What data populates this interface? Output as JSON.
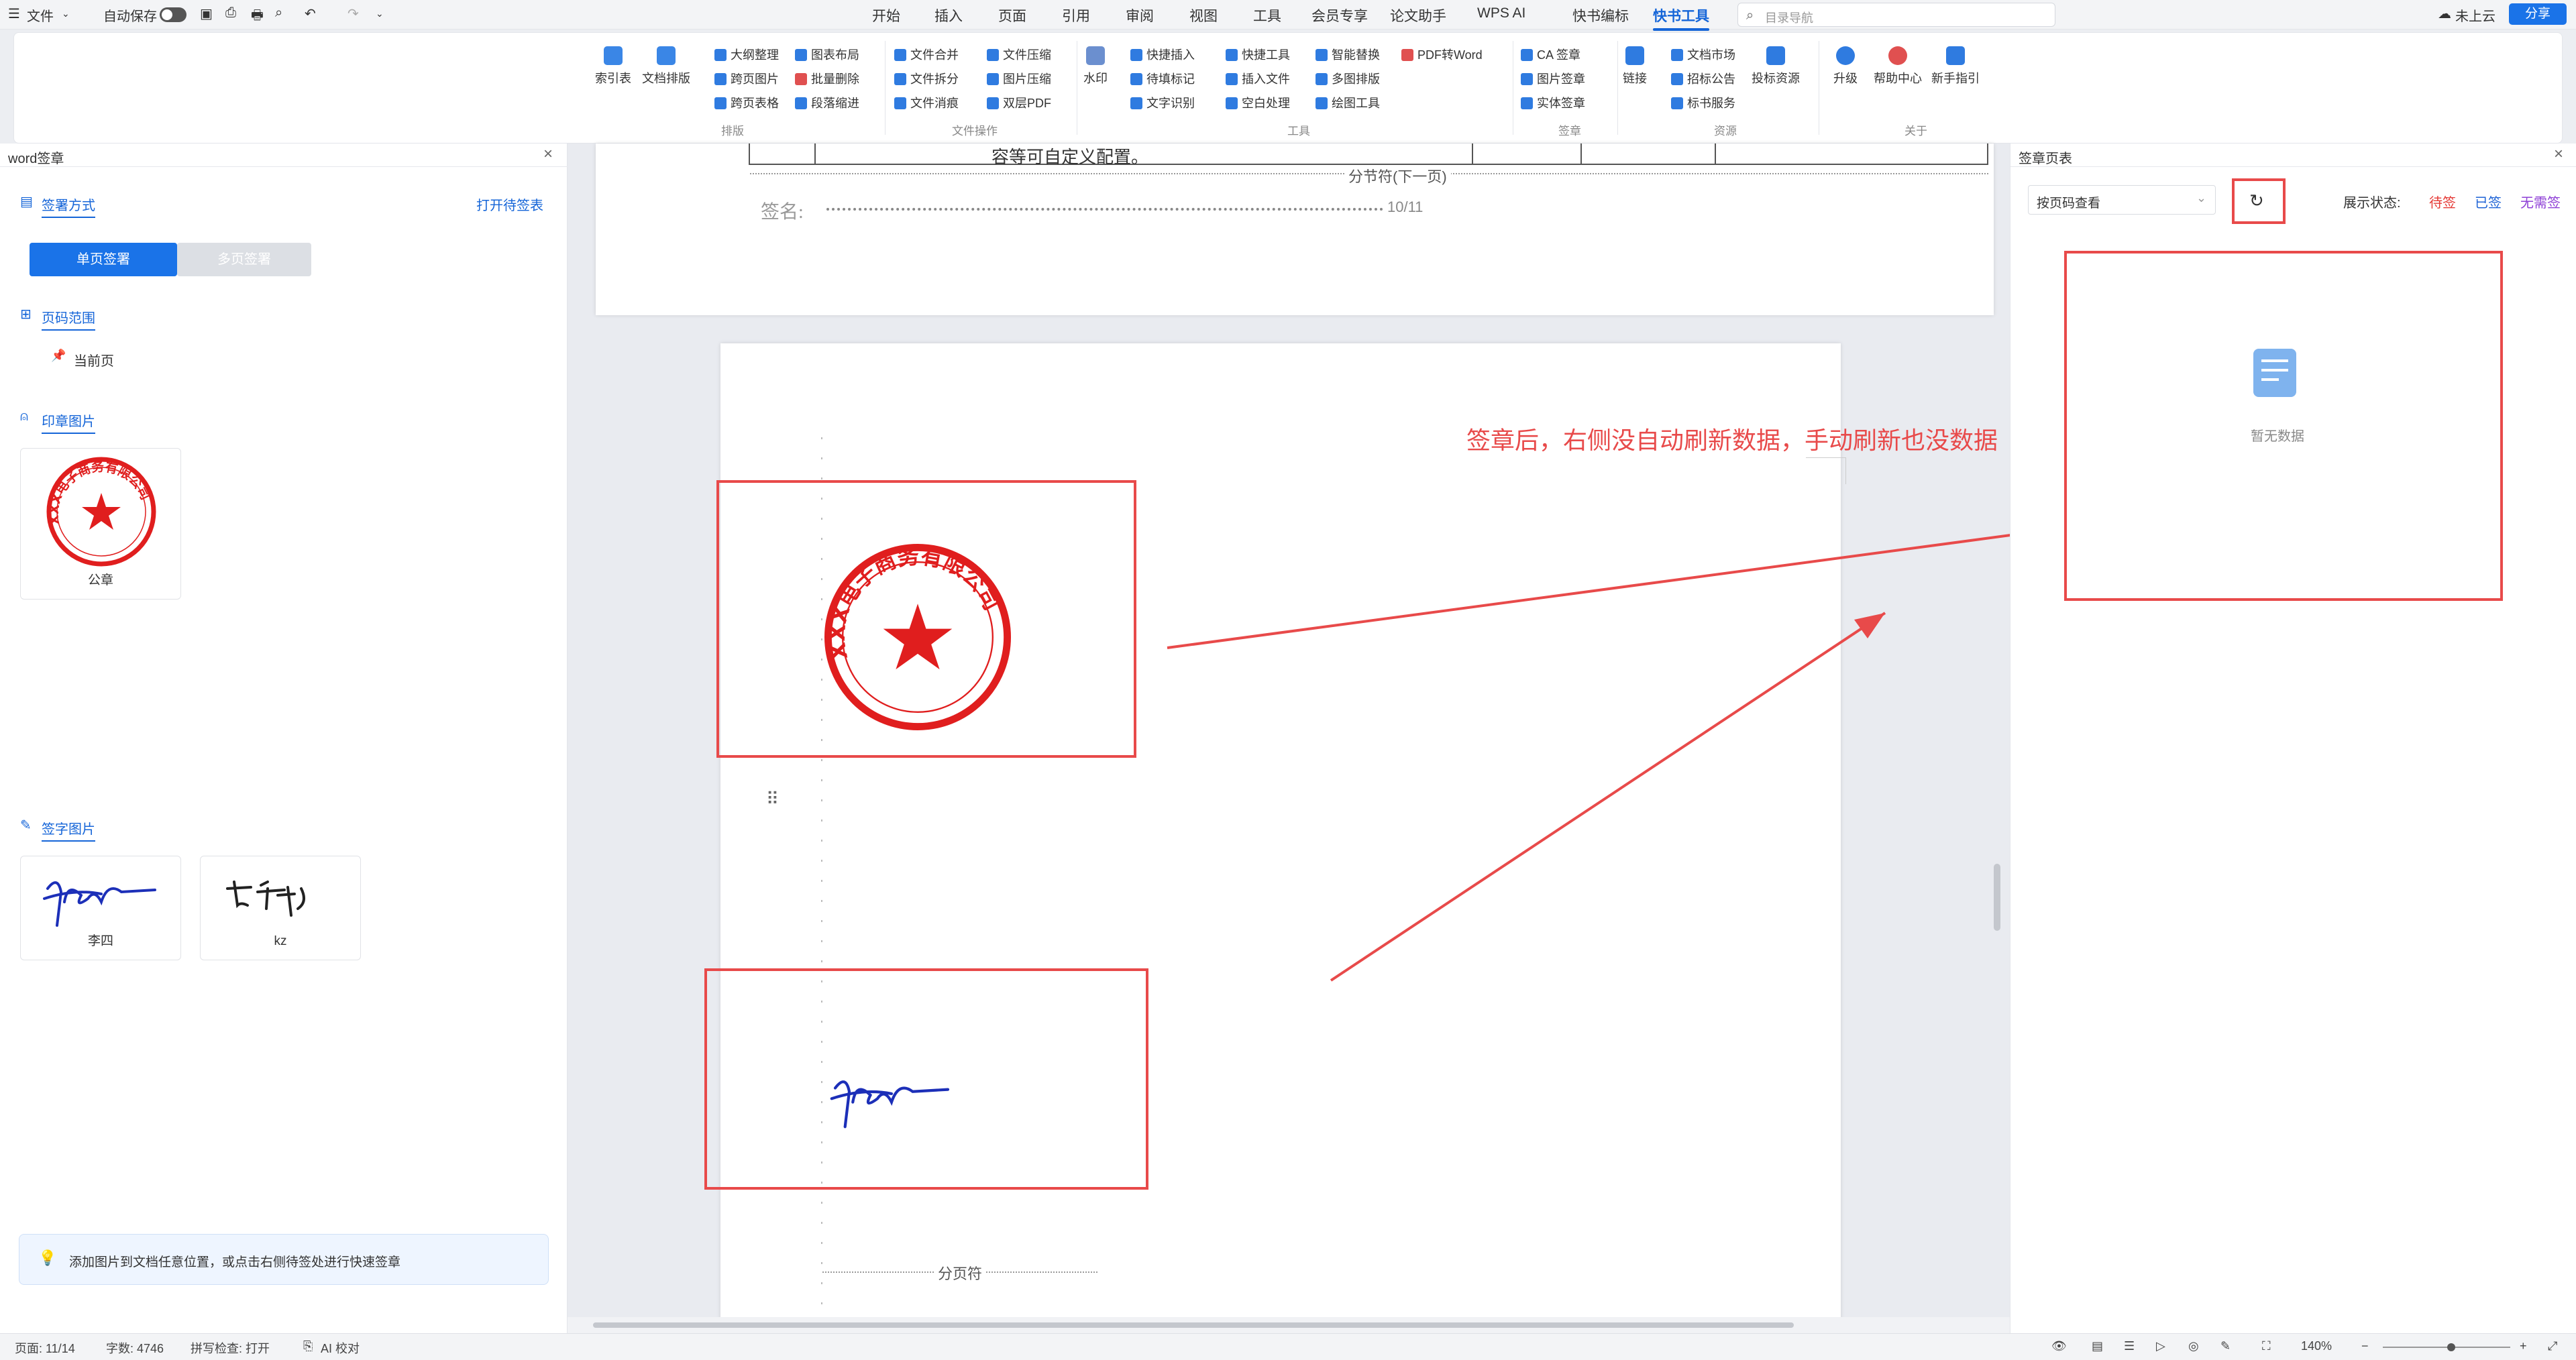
{
  "topbar": {
    "file_menu": "文件",
    "autosave_label": "自动保存",
    "tabs": [
      "开始",
      "插入",
      "页面",
      "引用",
      "审阅",
      "视图",
      "工具",
      "会员专享",
      "论文助手",
      "WPS AI",
      "快书编标",
      "快书工具"
    ],
    "active_tab": "快书工具",
    "search_placeholder": "目录导航",
    "cloud_status": "未上云",
    "share_label": "分享"
  },
  "ribbon": {
    "big_buttons": [
      "索引表",
      "文档排版",
      "水印",
      "链接",
      "投标资源",
      "升级",
      "帮助中心",
      "新手指引"
    ],
    "small_buttons": {
      "col1": [
        "大纲整理",
        "跨页图片",
        "跨页表格"
      ],
      "col2": [
        "图表布局",
        "批量删除",
        "段落缩进"
      ],
      "col3": [
        "文件合并",
        "文件拆分",
        "文件消痕"
      ],
      "col4": [
        "文件压缩",
        "图片压缩",
        "双层PDF"
      ],
      "col5": [
        "快捷插入",
        "待填标记",
        "文字识别"
      ],
      "col6": [
        "快捷工具",
        "插入文件",
        "空白处理"
      ],
      "col7": [
        "智能替换",
        "多图排版",
        "绘图工具"
      ],
      "col8": [
        "PDF转Word"
      ],
      "col9": [
        "CA 签章",
        "图片签章",
        "实体签章"
      ],
      "col10": [
        "文档市场",
        "招标公告",
        "标书服务"
      ]
    },
    "group_labels": [
      "排版",
      "文件操作",
      "工具",
      "签章",
      "资源",
      "关于"
    ]
  },
  "left_panel": {
    "title": "word签章",
    "section_sign_mode": "签署方式",
    "open_sign_table": "打开待签表",
    "mode_single": "单页签署",
    "mode_multi": "多页签署",
    "section_page_range": "页码范围",
    "current_page": "当前页",
    "section_seal_images": "印章图片",
    "seal_caption": "公章",
    "section_signature_images": "签字图片",
    "signatures": [
      "李四",
      "kz"
    ],
    "tip": "添加图片到文档任意位置，或点击右侧待签处进行快速签章"
  },
  "document": {
    "upper_text": "容等可自定义配置。",
    "section_break": "分节符(下一页)",
    "sign_label": "签名:",
    "sign_page": "10/11",
    "page_break": "分页符",
    "annotation": "签章后，右侧没自动刷新数据，手动刷新也没数据",
    "seal_text": "XXX电子商务有限公司"
  },
  "right_panel": {
    "title": "签章页表",
    "view_select": "按页码查看",
    "status_label": "展示状态:",
    "status_pending": "待签",
    "status_signed": "已签",
    "status_none": "无需签",
    "empty_text": "暂无数据",
    "colors": {
      "pending": "#e53935",
      "signed": "#1e63d6",
      "none": "#8e3fd6"
    }
  },
  "statusbar": {
    "page": "页面: 11/14",
    "words": "字数: 4746",
    "spell": "拼写检查: 打开",
    "ai": "AI 校对",
    "zoom": "140%"
  }
}
